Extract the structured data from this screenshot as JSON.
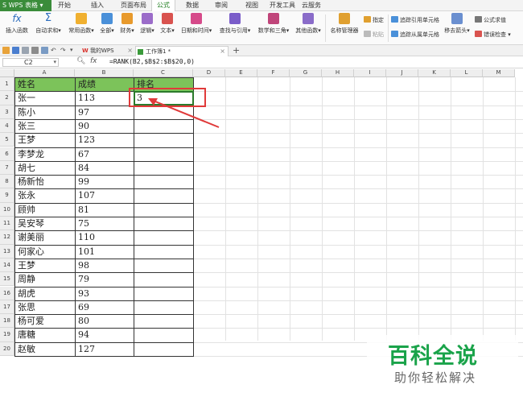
{
  "app": {
    "name": "WPS 表格"
  },
  "menu_tabs": [
    "开始",
    "插入",
    "页面布局",
    "公式",
    "数据",
    "审阅",
    "视图",
    "开发工具",
    "云服务"
  ],
  "active_menu_tab": "公式",
  "ribbon": {
    "insert_function": "插入函数",
    "autosum": "自动求和",
    "common_functions": "常用函数",
    "all": "全部",
    "financial": "财务",
    "logical": "逻辑",
    "text": "文本",
    "datetime": "日期和时间",
    "lookup": "查找与引用",
    "math": "数学和三角",
    "other": "其他函数",
    "name_manager": "名称管理器",
    "define": "指定",
    "paste": "粘贴",
    "trace_precedents": "追踪引用单元格",
    "trace_dependents": "追踪从属单元格",
    "remove_arrows": "移去箭头",
    "formula_eval": "公式求值",
    "error_check": "错误检查"
  },
  "doc_tabs": [
    {
      "label": "我的WPS"
    },
    {
      "label": "工作簿1 *"
    }
  ],
  "formula_bar": {
    "cell_ref": "C2",
    "fx": "fx",
    "formula": "=RANK(B2,$B$2:$B$20,0)"
  },
  "columns": [
    "A",
    "B",
    "C",
    "D",
    "E",
    "F",
    "G",
    "H",
    "I",
    "J",
    "K",
    "L",
    "M"
  ],
  "table": {
    "headers": [
      "姓名",
      "成绩",
      "排名"
    ],
    "rows": [
      [
        "张一",
        "113",
        "3"
      ],
      [
        "陈小",
        "97",
        ""
      ],
      [
        "张三",
        "90",
        ""
      ],
      [
        "王梦",
        "123",
        ""
      ],
      [
        "李梦龙",
        "67",
        ""
      ],
      [
        "胡七",
        "84",
        ""
      ],
      [
        "杨新怡",
        "99",
        ""
      ],
      [
        "张永",
        "107",
        ""
      ],
      [
        "顾帅",
        "81",
        ""
      ],
      [
        "吴安琴",
        "75",
        ""
      ],
      [
        "谢美丽",
        "110",
        ""
      ],
      [
        "何家心",
        "101",
        ""
      ],
      [
        "王梦",
        "98",
        ""
      ],
      [
        "周静",
        "79",
        ""
      ],
      [
        "胡虎",
        "93",
        ""
      ],
      [
        "张思",
        "69",
        ""
      ],
      [
        "杨可爱",
        "80",
        ""
      ],
      [
        "唐糖",
        "94",
        ""
      ],
      [
        "赵敏",
        "127",
        ""
      ]
    ]
  },
  "watermark": {
    "title": "百科全说",
    "subtitle": "助你轻松解决"
  },
  "colors": {
    "header_fill": "#7cc35a",
    "accent": "#2b7a2b",
    "annotation": "#e03a3a",
    "watermark": "#1aa34a"
  }
}
